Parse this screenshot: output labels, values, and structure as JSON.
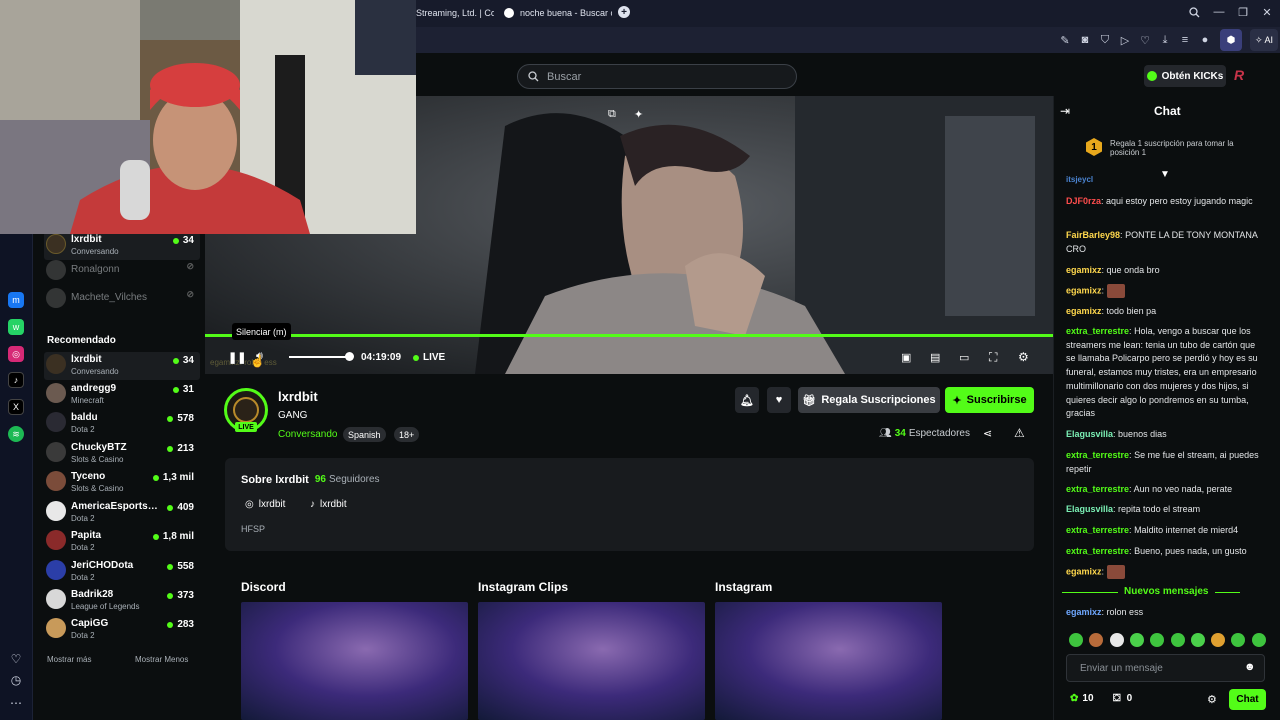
{
  "browser": {
    "tabs": [
      {
        "label": "Streaming, Ltd. | Cont"
      },
      {
        "label": "noche buena - Buscar con"
      }
    ],
    "new_tab": "+",
    "ai_label": "AI",
    "window": {
      "minimize": "—",
      "restore": "❐",
      "close": "✕"
    }
  },
  "header": {
    "search_placeholder": "Buscar",
    "kicks_button": "Obtén KICKs"
  },
  "sidebar": {
    "following": [
      {
        "name": "lxrdbit",
        "category": "Conversando",
        "viewers": "34"
      },
      {
        "name": "Ronalgonn"
      },
      {
        "name": "Machete_Vilches"
      }
    ],
    "recommended_title": "Recomendado",
    "recommended": [
      {
        "name": "lxrdbit",
        "category": "Conversando",
        "viewers": "34",
        "color": "#3b3022"
      },
      {
        "name": "andregg9",
        "category": "Minecraft",
        "viewers": "31",
        "color": "#6b5a50"
      },
      {
        "name": "baldu",
        "category": "Dota 2",
        "viewers": "578",
        "color": "#2a2a33"
      },
      {
        "name": "ChuckyBTZ",
        "category": "Slots & Casino",
        "viewers": "213",
        "color": "#3a3a3a"
      },
      {
        "name": "Tyceno",
        "category": "Slots & Casino",
        "viewers": "1,3 mil",
        "color": "#7b4c3a"
      },
      {
        "name": "AmericaEsportsD...",
        "category": "Dota 2",
        "viewers": "409",
        "color": "#e8e8e8"
      },
      {
        "name": "Papita",
        "category": "Dota 2",
        "viewers": "1,8 mil",
        "color": "#8a2a2a"
      },
      {
        "name": "JeriCHODota",
        "category": "Dota 2",
        "viewers": "558",
        "color": "#2b3ea8"
      },
      {
        "name": "Badrik28",
        "category": "League of Legends",
        "viewers": "373",
        "color": "#d8d8d8"
      },
      {
        "name": "CapiGG",
        "category": "Dota 2",
        "viewers": "283",
        "color": "#c89a5a"
      }
    ],
    "show_more": "Mostrar más",
    "show_less": "Mostrar Menos"
  },
  "player": {
    "tooltip": "Silenciar (m)",
    "time": "04:19:09",
    "live": "LIVE",
    "overlay_text": "egamixz: rolon ess",
    "volume": 0.95,
    "progress": 1.0
  },
  "channel": {
    "name": "lxrdbit",
    "title": "GANG",
    "category": "Conversando",
    "tags": [
      "Spanish",
      "18+"
    ],
    "live_badge": "LIVE",
    "gift_button": "Regala Suscripciones",
    "subscribe_button": "Suscribirse",
    "viewers": "34",
    "viewers_label": "Espectadores"
  },
  "about": {
    "title": "Sobre lxrdbit",
    "followers": "96",
    "followers_label": "Seguidores",
    "socials": [
      {
        "name": "lxrdbit",
        "icon": "instagram-icon"
      },
      {
        "name": "lxrdbit",
        "icon": "tiktok-icon"
      }
    ],
    "bio": "HFSP"
  },
  "panels": [
    {
      "title": "Discord"
    },
    {
      "title": "Instagram Clips"
    },
    {
      "title": "Instagram"
    }
  ],
  "chat": {
    "title": "Chat",
    "pinned": "Regala 1 suscripción para tomar la posición 1",
    "pinned_rank": "1",
    "messages": [
      {
        "user": "DJF0rza",
        "text": "aqui estoy pero estoy jugando magic",
        "color": "#ff4d4d"
      },
      {
        "user": "FairBarley98",
        "text": "PONTE LA DE TONY MONTANA CRO",
        "color": "#ffd84d"
      },
      {
        "user": "egamixz",
        "text": "que onda bro",
        "color": "#ffd84d"
      },
      {
        "user": "egamixz",
        "text": "",
        "color": "#ffd84d"
      },
      {
        "user": "egamixz",
        "text": "todo bien pa",
        "color": "#ffd84d"
      },
      {
        "user": "extra_terrestre",
        "text": "Hola, vengo a buscar que los streamers me lean: tenia un tubo de cartón que se llamaba Policarpo pero se perdió y hoy es su funeral, estamos muy tristes, era un empresario multimillonario con dos mujeres y dos hijos, si quieres decir algo lo pondremos en su tumba, gracias",
        "color": "#53fc18"
      },
      {
        "user": "Elagusvilla",
        "text": "buenos dias",
        "color": "#7bf0b5"
      },
      {
        "user": "extra_terrestre",
        "text": "Se me fue el stream, ai puedes repetir",
        "color": "#53fc18"
      },
      {
        "user": "extra_terrestre",
        "text": "Aun no veo nada, perate",
        "color": "#53fc18"
      },
      {
        "user": "Elagusvilla",
        "text": "repita todo el stream",
        "color": "#7bf0b5"
      },
      {
        "user": "extra_terrestre",
        "text": "Maldito internet de mierd4",
        "color": "#53fc18"
      },
      {
        "user": "extra_terrestre",
        "text": "Bueno, pues nada, un gusto",
        "color": "#53fc18"
      },
      {
        "user": "egamixz",
        "text": "",
        "color": "#ffd84d"
      }
    ],
    "partial_top_user": "itsjeycl",
    "new_messages": "Nuevos mensajes",
    "last_message": {
      "user": "egamixz",
      "text": "rolon ess",
      "color": "#6fa8ff"
    },
    "input_placeholder": "Enviar un mensaje",
    "points": "10",
    "gifts": "0",
    "send_button": "Chat"
  },
  "colors": {
    "accent": "#53fc18",
    "background": "#0b0e0f"
  }
}
